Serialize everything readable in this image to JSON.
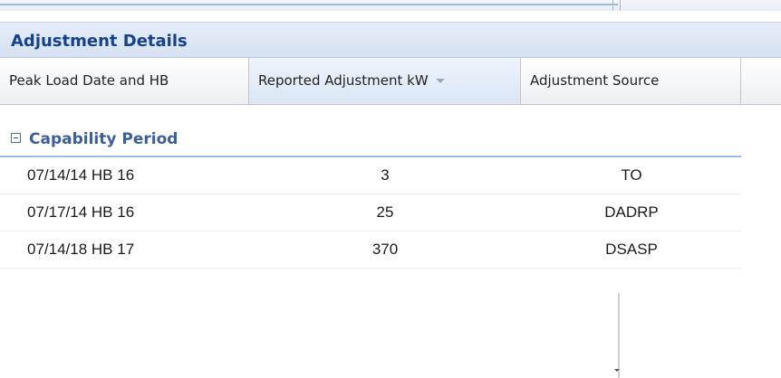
{
  "panel": {
    "title": "Adjustment Details"
  },
  "columns": [
    {
      "label": "Peak Load Date and HB",
      "sorted": false
    },
    {
      "label": "Reported Adjustment kW",
      "sorted": true,
      "sort_direction": "descending"
    },
    {
      "label": "Adjustment Source",
      "sorted": false
    }
  ],
  "group": {
    "label": "Capability Period",
    "expanded": true
  },
  "rows": [
    {
      "date_hb": "07/14/14 HB 16",
      "kw": "3",
      "source": "TO"
    },
    {
      "date_hb": "07/17/14 HB 16",
      "kw": "25",
      "source": "DADRP"
    },
    {
      "date_hb": "07/14/18 HB 17",
      "kw": "370",
      "source": "DSASP"
    }
  ],
  "colors": {
    "title_text": "#15428b",
    "group_text": "#3b5e99",
    "group_divider": "#99bbe8",
    "sorted_header_bg": "#dbe6f5"
  }
}
